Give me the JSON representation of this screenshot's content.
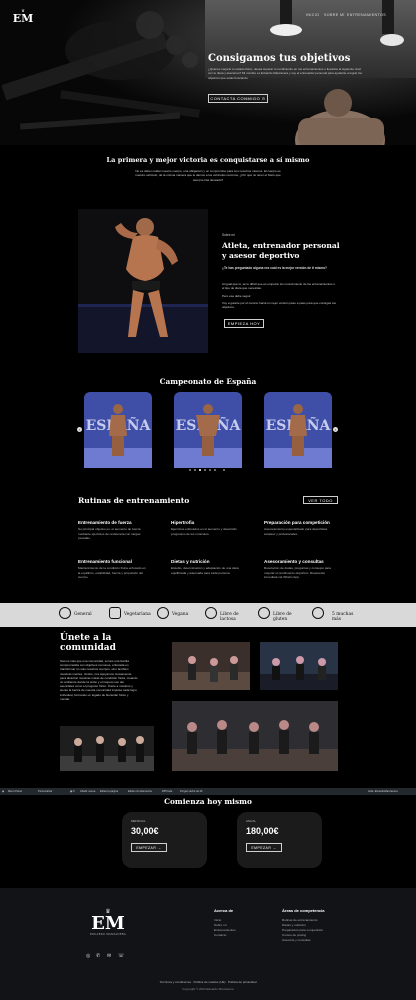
{
  "nav": {
    "logo": "EM",
    "items": [
      "INICIO",
      "SOBRE MÍ",
      "ENTRENAMIENTOS"
    ]
  },
  "hero": {
    "title": "Consigamos tus objetivos",
    "text": "¿Quieres mejorar tu estado físico, desea superar tu rendimiento en tus entrenamientos o llevarlos al siguiente nivel con tu dieta y descanso? Mi nombre es Eduardo Manzanera y soy el entrenador personal para ayudarte a lograr los objetivos que estás buscando.",
    "cta": "CONTACTA CONMIGO ⊙"
  },
  "intro": {
    "title": "La primera y mejor victoria es conquistarse a sí mismo",
    "text": "No es deber cuidar nuestro cuerpo, una obligación y un compromiso para con nosotros mismos. El cuerpo es nuestro vehículo, de la misma manera que le damos a los vehículos recursos, ¿Por qué no tener el físico que siempre has deseado?"
  },
  "about": {
    "eyebrow": "Sobre mí",
    "title": "Atleta, entrenador personal y asesor deportivo",
    "q": "¿Te has preguntado alguna vez cuál es la mejor versión de ti mismo?",
    "p1": "Al igual que tú, sé lo difícil que es empezar sin conocimiento de los entrenamientos o el tipo de dieta que necesitas.",
    "p2": "Pero ese debe seguir.",
    "p3": "Voy a guiarte por el camino hacia tu mejor versión paso a paso para que consigas tus objetivos.",
    "cta": "EMPIEZA HOY"
  },
  "championship": {
    "title": "Campeonato de España",
    "badge": "ESPAÑA",
    "slides": 3
  },
  "routines": {
    "title": "Rutinas de entrenamiento",
    "cta": "VER TODO",
    "items": [
      {
        "title": "Entrenamiento de fuerza",
        "desc": "Su principal objetivo es: el aumento de fuerza mediante ejercicios de resistencia con cargas pesadas."
      },
      {
        "title": "Hipertrofia",
        "desc": "Ejercicios enfocados en el aumento y desarrollo progresivo de los músculos."
      },
      {
        "title": "Preparación para competición",
        "desc": "Asesoramiento especializado para deportistas amateur y profesionales."
      },
      {
        "title": "Entrenamiento funcional",
        "desc": "Mantenimiento de la condición física enfocado en la equilibrio, estabilidad, fuerza y propulsión del cuerpo."
      },
      {
        "title": "Dietas y nutrición",
        "desc": "Estudio, determinación y adaptación de una dieta equilibrada y adecuada para cada persona."
      },
      {
        "title": "Asesoramiento y consultas",
        "desc": "Resolución de dudas, preguntas y consejos para mejorar el rendimiento deportivo. Respuesta inmediata vía What's App."
      }
    ]
  },
  "diets": [
    "General",
    "Vegetariana",
    "Vegana",
    "Libre de lactosa",
    "Libre de gluten",
    "5 muchas más"
  ],
  "community": {
    "title": "Únete a la comunidad",
    "text": "Somos más que una comunidad, somos una familia comprometida con objetivos comunes, enfocada en transformar no solo nuestros cuerpos, sino también nuestras mentes. Juntos, nos apoyamos mutuamente para alcanzar nuestras metas de condición física, creando un ambiente donde la unión y el respeto son tan esenciales como el progreso físico. Únete a nosotros y siente la fuerza de nuestra comunidad impulsa cada logro individual, formando un legado de bienestar físico y mental."
  },
  "start": {
    "title": "Comienza hoy mismo",
    "plans": [
      {
        "name": "MENSUAL",
        "price": "30,00€",
        "cta": "EMPEZAR →"
      },
      {
        "name": "ANUAL",
        "price": "180,00€",
        "cta": "EMPEZAR →"
      }
    ]
  },
  "toolbar": [
    "Menú Panel",
    "Personalizar",
    "",
    "Añadir nueva",
    "Editar la página",
    "Editar con Elementor",
    "WPCode",
    "Purgar caché de lib",
    "Hola, EduardoManzanera"
  ],
  "footer": {
    "brand": "EDUARDO MANZANERA",
    "col1": {
      "title": "Acerca de",
      "links": [
        "Inicio",
        "Sobre mí",
        "Entrenamientos",
        "Contacto"
      ]
    },
    "col2": {
      "title": "Áreas de competencia",
      "links": [
        "Rutinas de entrenamiento",
        "Dietas y nutrición",
        "Preparación para competición",
        "Cursos de posing",
        "Asesoría y consultas"
      ]
    },
    "legal": "Términos y condiciones   Política de cookies (UE)   Política de privacidad",
    "copy": "Copyright © 2024 Eduardo Manzanera"
  },
  "colors": {
    "bg": "#000000",
    "diet_band": "#d9d9d9",
    "card": "#1b1b1b",
    "footer": "#111317"
  }
}
